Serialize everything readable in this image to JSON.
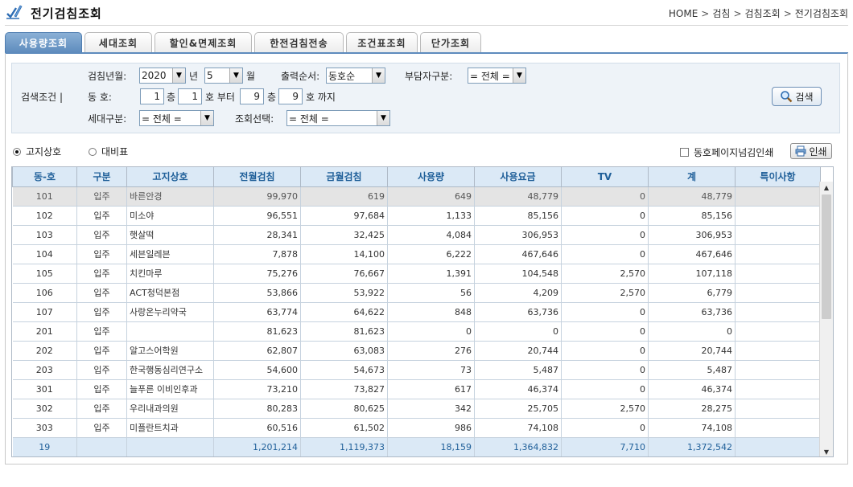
{
  "header": {
    "title": "전기검침조회",
    "breadcrumb": [
      "HOME",
      "검침",
      "검침조회",
      "전기검침조회"
    ]
  },
  "tabs": [
    {
      "label": "사용량조회",
      "active": true
    },
    {
      "label": "세대조회",
      "active": false
    },
    {
      "label": "할인&면제조회",
      "active": false
    },
    {
      "label": "한전검침전송",
      "active": false
    },
    {
      "label": "조건표조회",
      "active": false
    },
    {
      "label": "단가조회",
      "active": false
    }
  ],
  "search": {
    "section_label": "검색조건 |",
    "meter_month_label": "검침년월:",
    "year_value": "2020",
    "year_unit": "년",
    "month_value": "5",
    "month_unit": "월",
    "order_label": "출력순서:",
    "order_value": "동호순",
    "payer_label": "부담자구분:",
    "payer_value": "= 전체 =",
    "dongho_label": "동 호:",
    "from_dong": "1",
    "floor_unit_1": "층",
    "from_ho": "1",
    "ho_from": "호 부터",
    "to_dong": "9",
    "floor_unit_2": "층",
    "to_ho": "9",
    "ho_to": "호 까지",
    "household_label": "세대구분:",
    "household_value": "= 전체 =",
    "query_label": "조회선택:",
    "query_value": "= 전체 =",
    "search_button": "검색"
  },
  "options": {
    "radio_1": "고지상호",
    "radio_2": "대비표",
    "radio_selected": 1,
    "checkbox_label": "동호페이지넘김인쇄",
    "checkbox_checked": false,
    "print_button": "인쇄"
  },
  "table": {
    "columns": [
      "동-호",
      "구분",
      "고지상호",
      "전월검침",
      "금월검침",
      "사용량",
      "사용요금",
      "TV",
      "계",
      "특이사항"
    ],
    "rows": [
      [
        "101",
        "입주",
        "바른안경",
        "99,970",
        "619",
        "649",
        "48,779",
        "0",
        "48,779",
        ""
      ],
      [
        "102",
        "입주",
        "미소야",
        "96,551",
        "97,684",
        "1,133",
        "85,156",
        "0",
        "85,156",
        ""
      ],
      [
        "103",
        "입주",
        "햇살떡",
        "28,341",
        "32,425",
        "4,084",
        "306,953",
        "0",
        "306,953",
        ""
      ],
      [
        "104",
        "입주",
        "세븐일레븐",
        "7,878",
        "14,100",
        "6,222",
        "467,646",
        "0",
        "467,646",
        ""
      ],
      [
        "105",
        "입주",
        "치킨마루",
        "75,276",
        "76,667",
        "1,391",
        "104,548",
        "2,570",
        "107,118",
        ""
      ],
      [
        "106",
        "입주",
        "ACT청덕본점",
        "53,866",
        "53,922",
        "56",
        "4,209",
        "2,570",
        "6,779",
        ""
      ],
      [
        "107",
        "입주",
        "사랑온누리약국",
        "63,774",
        "64,622",
        "848",
        "63,736",
        "0",
        "63,736",
        ""
      ],
      [
        "201",
        "입주",
        "",
        "81,623",
        "81,623",
        "0",
        "0",
        "0",
        "0",
        ""
      ],
      [
        "202",
        "입주",
        "알고스어학원",
        "62,807",
        "63,083",
        "276",
        "20,744",
        "0",
        "20,744",
        ""
      ],
      [
        "203",
        "입주",
        "한국행동심리연구소",
        "54,600",
        "54,673",
        "73",
        "5,487",
        "0",
        "5,487",
        ""
      ],
      [
        "301",
        "입주",
        "늘푸른 이비인후과",
        "73,210",
        "73,827",
        "617",
        "46,374",
        "0",
        "46,374",
        ""
      ],
      [
        "302",
        "입주",
        "우리내과의원",
        "80,283",
        "80,625",
        "342",
        "25,705",
        "2,570",
        "28,275",
        ""
      ],
      [
        "303",
        "입주",
        "미플란트치과",
        "60,516",
        "61,502",
        "986",
        "74,108",
        "0",
        "74,108",
        ""
      ]
    ],
    "total": [
      "19",
      "",
      "",
      "1,201,214",
      "1,119,373",
      "18,159",
      "1,364,832",
      "7,710",
      "1,372,542",
      ""
    ]
  }
}
